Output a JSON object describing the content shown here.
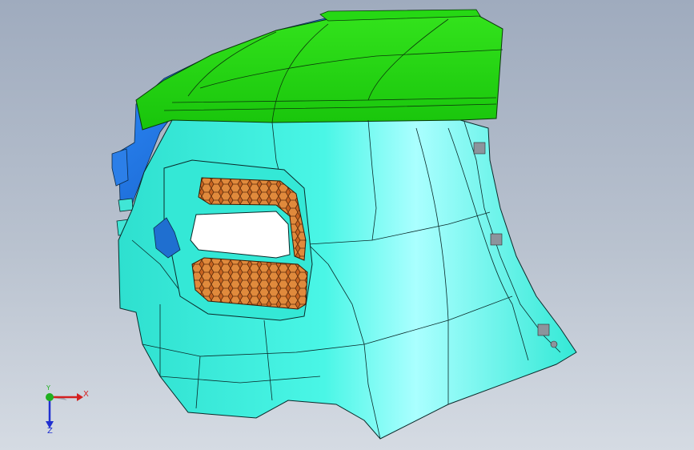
{
  "triad": {
    "x_label": "X",
    "y_label": "Y",
    "z_label": "Z",
    "x_color": "#d42020",
    "y_color": "#20b020",
    "z_color": "#2030d0"
  },
  "model": {
    "colors": {
      "body": "#3ff2de",
      "top_cover": "#22d20f",
      "blue_trim": "#1e72dc",
      "grille_mesh": "#d06f1e",
      "edge": "#0a2a2a"
    },
    "icons": {
      "grille_upper": "honeycomb-grille-icon",
      "grille_lower": "honeycomb-grille-icon"
    }
  }
}
